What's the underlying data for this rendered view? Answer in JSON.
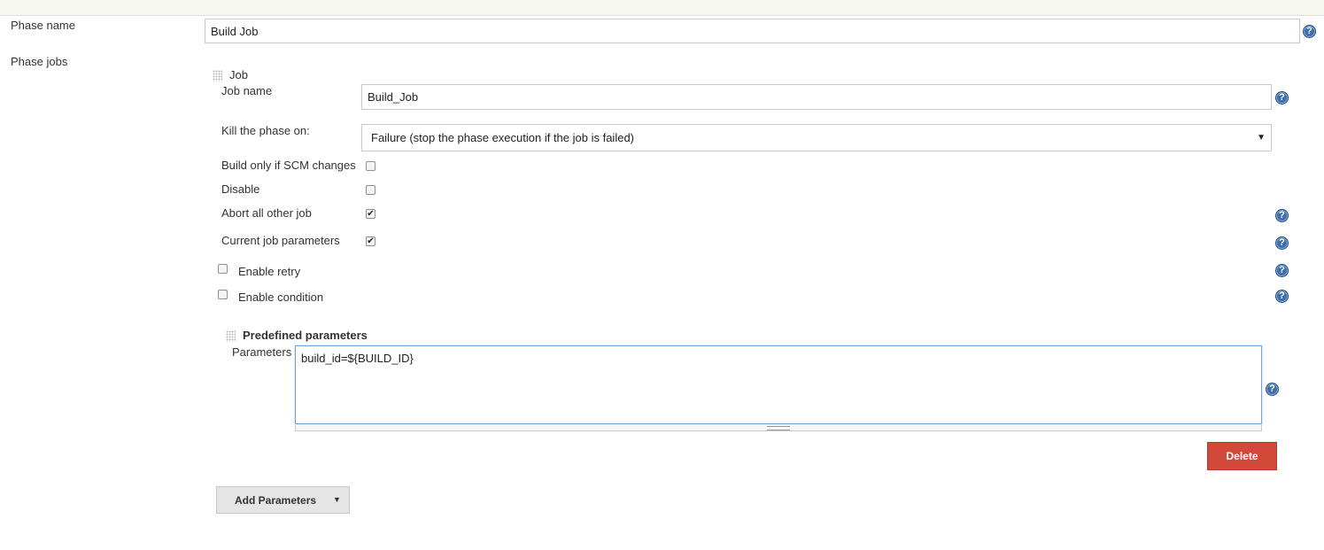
{
  "phase": {
    "name_label": "Phase name",
    "name_value": "Build Job",
    "jobs_label": "Phase jobs"
  },
  "job": {
    "header": "Job",
    "job_name_label": "Job name",
    "job_name_value": "Build_Job",
    "kill_label": "Kill the phase on:",
    "kill_value": "Failure (stop the phase execution if the job is failed)",
    "build_scm_label": "Build only if SCM changes",
    "build_scm_checked": false,
    "disable_label": "Disable",
    "disable_checked": false,
    "abort_label": "Abort all other job",
    "abort_checked": true,
    "current_params_label": "Current job parameters",
    "current_params_checked": true,
    "enable_retry_label": "Enable retry",
    "enable_retry_checked": false,
    "enable_condition_label": "Enable condition",
    "enable_condition_checked": false
  },
  "predefined": {
    "header": "Predefined parameters",
    "parameters_label": "Parameters",
    "parameters_value": "build_id=${BUILD_ID}"
  },
  "buttons": {
    "delete_label": "Delete",
    "add_parameters_label": "Add Parameters"
  },
  "glyphs": {
    "help": "?",
    "check": "✔",
    "caret": "▼"
  },
  "colors": {
    "help_blue": "#3f6ea8",
    "delete_red": "#d24939",
    "textarea_focus_border": "#7aa1d6"
  }
}
